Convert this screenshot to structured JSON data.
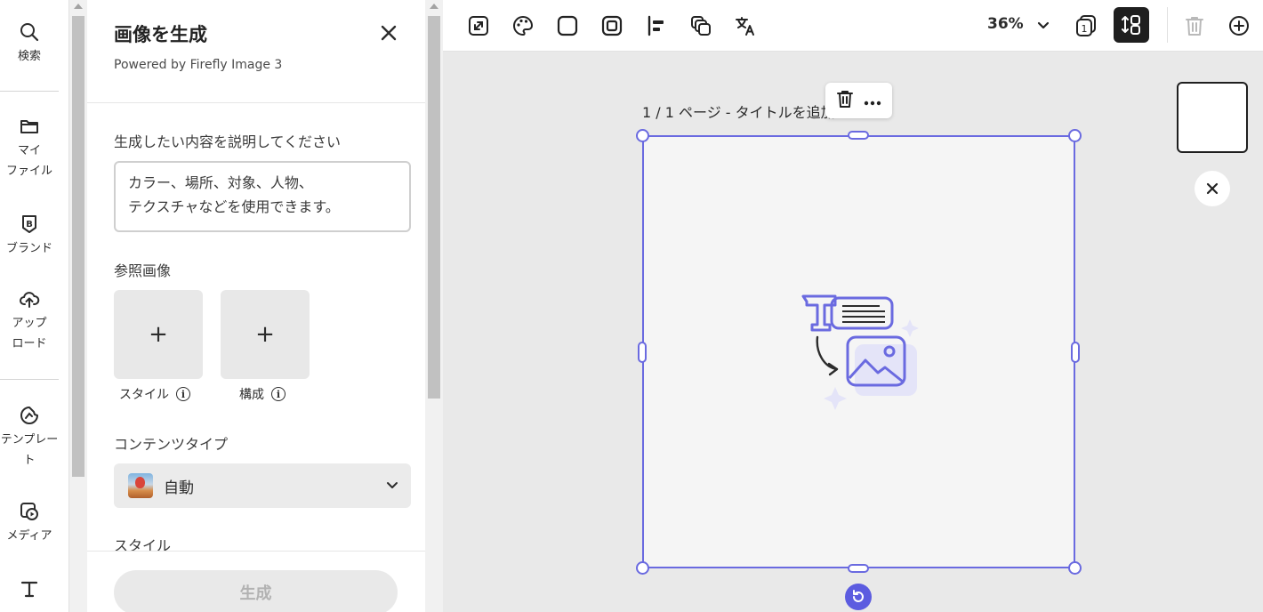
{
  "rail": {
    "items": [
      {
        "id": "search",
        "label": "検索",
        "icon": "search-icon"
      },
      {
        "id": "myfiles",
        "label": "マイ\nファイル",
        "icon": "folder-icon"
      },
      {
        "id": "brand",
        "label": "ブランド",
        "icon": "brand-icon"
      },
      {
        "id": "upload",
        "label": "アップ\nロード",
        "icon": "upload-cloud-icon"
      },
      {
        "id": "templates",
        "label": "テンプレー\nト",
        "icon": "template-icon"
      },
      {
        "id": "media",
        "label": "メディア",
        "icon": "media-icon"
      },
      {
        "id": "text",
        "label": "",
        "icon": "text-icon"
      }
    ]
  },
  "panel": {
    "title": "画像を生成",
    "subtitle": "Powered by Firefly Image 3",
    "prompt_label": "生成したい内容を説明してください",
    "prompt_placeholder": "カラー、場所、対象、人物、\nテクスチャなどを使用できます。",
    "reference_label": "参照画像",
    "reference_tiles": [
      {
        "caption": "スタイル",
        "add": "+"
      },
      {
        "caption": "構成",
        "add": "+"
      }
    ],
    "info_glyph": "i",
    "content_type_label": "コンテンツタイプ",
    "content_type_value": "自動",
    "style_label": "スタイル",
    "generate_label": "生成"
  },
  "toolbar": {
    "zoom": "36%",
    "page_count": "1"
  },
  "canvas": {
    "page_title": "1 / 1 ページ - タイトルを追加"
  },
  "colors": {
    "accent": "#6a6ae0",
    "active_button": "#1f1f1f"
  }
}
